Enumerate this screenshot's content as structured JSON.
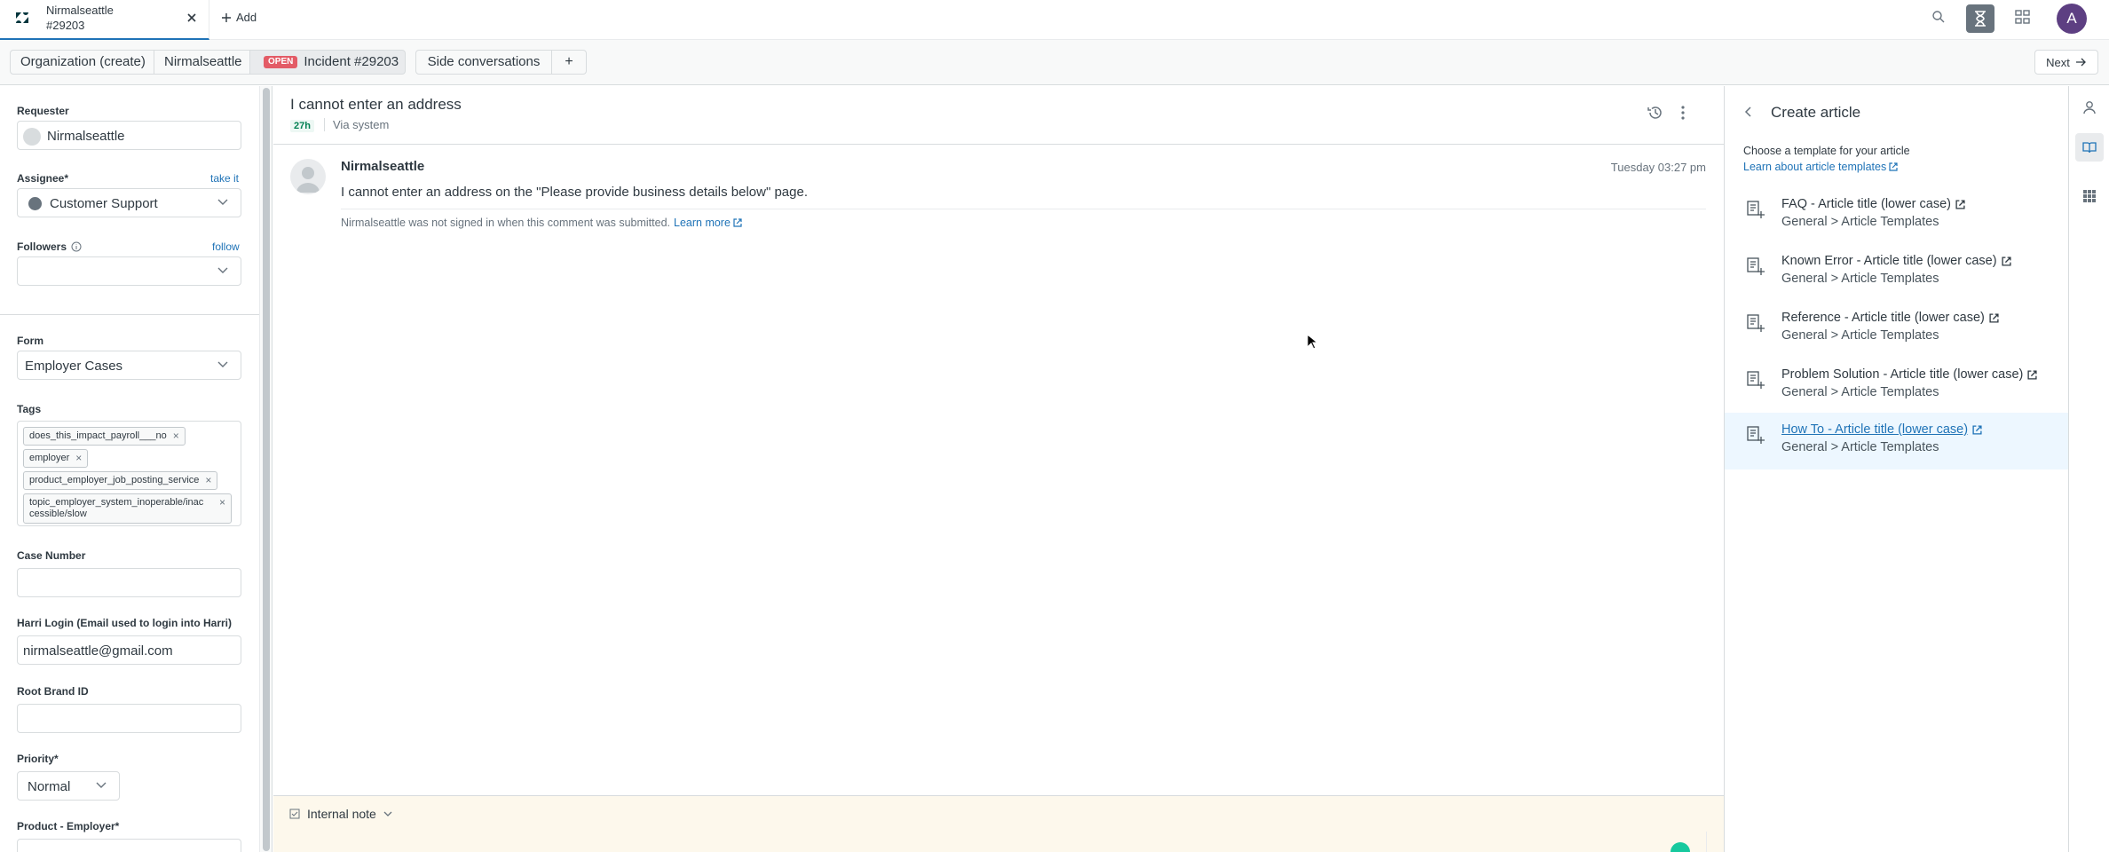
{
  "tabs": {
    "active_title_line1": "Nirmalseattle",
    "active_title_line2": "#29203",
    "add_label": "Add"
  },
  "breadcrumb": {
    "organization": "Organization (create)",
    "user": "Nirmalseattle",
    "status_badge": "OPEN",
    "incident": "Incident #29203",
    "side_conversations": "Side conversations",
    "plus": "+",
    "next": "Next"
  },
  "user_avatar_letter": "A",
  "sidebar": {
    "requester_label": "Requester",
    "requester_value": "Nirmalseattle",
    "assignee_label": "Assignee*",
    "take_it": "take it",
    "assignee_value": "Customer Support",
    "followers_label": "Followers",
    "follow": "follow",
    "form_label": "Form",
    "form_value": "Employer Cases",
    "tags_label": "Tags",
    "tags": [
      "does_this_impact_payroll___no",
      "employer",
      "product_employer_job_posting_service",
      "topic_employer_system_inoperable/inac cessible/slow"
    ],
    "case_number_label": "Case Number",
    "case_number_value": "",
    "harri_login_label": "Harri Login (Email used to login into Harri)",
    "harri_login_value": "nirmalseattle@gmail.com",
    "root_brand_label": "Root Brand ID",
    "root_brand_value": "",
    "priority_label": "Priority*",
    "priority_value": "Normal",
    "product_label": "Product - Employer*"
  },
  "ticket": {
    "title": "I cannot enter an address",
    "age": "27h",
    "via": "Via system",
    "message": {
      "author": "Nirmalseattle",
      "time": "Tuesday 03:27 pm",
      "body": "I cannot enter an address on the \"Please provide business details below\" page.",
      "notice": "Nirmalseattle was not signed in when this comment was submitted.",
      "learn_more": "Learn more"
    },
    "composer_mode": "Internal note"
  },
  "create_article": {
    "title": "Create article",
    "subtitle": "Choose a template for your article",
    "learn_link": "Learn about article templates",
    "templates": [
      {
        "name": "FAQ - Article title (lower case)",
        "path": "General > Article Templates"
      },
      {
        "name": "Known Error - Article title (lower case)",
        "path": "General > Article Templates"
      },
      {
        "name": "Reference - Article title (lower case)",
        "path": "General > Article Templates"
      },
      {
        "name": "Problem Solution - Article title (lower case)",
        "path": "General > Article Templates"
      },
      {
        "name": "How To - Article title (lower case)",
        "path": "General > Article Templates"
      }
    ]
  },
  "colors": {
    "link": "#1f73b7",
    "open_badge": "#e35b66",
    "note_background": "#fdf8ec",
    "hover_row": "#edf7ff"
  }
}
